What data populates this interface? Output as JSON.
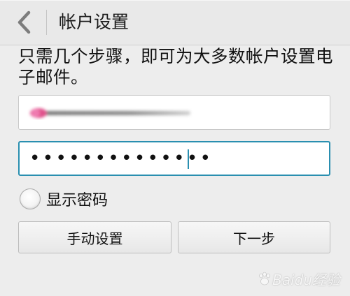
{
  "header": {
    "title": "帐户设置",
    "back_icon": "chevron-left-icon"
  },
  "intro": {
    "text": "只需几个步骤，即可为大多数帐户设置电子邮件。"
  },
  "email_field": {
    "value": ""
  },
  "password_field": {
    "masked_value": "••••••••••••••"
  },
  "show_password": {
    "label": "显示密码",
    "checked": false
  },
  "buttons": {
    "manual_label": "手动设置",
    "next_label": "下一步"
  },
  "watermark": {
    "brand": "Baidu经验"
  },
  "colors": {
    "accent": "#2a8fb0",
    "background": "#ededed"
  }
}
